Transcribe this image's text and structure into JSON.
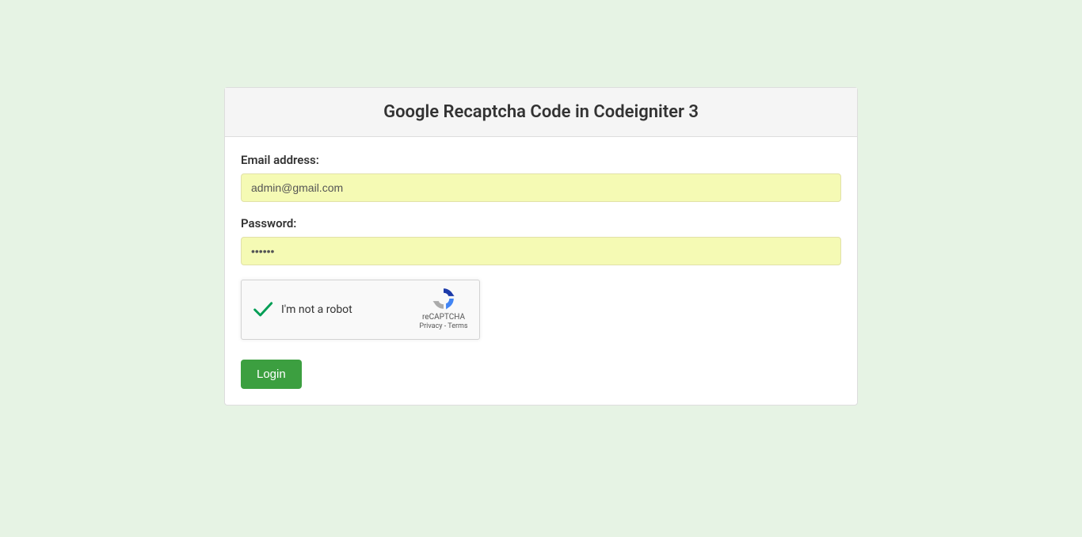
{
  "panel": {
    "title": "Google Recaptcha Code in Codeigniter 3"
  },
  "form": {
    "email_label": "Email address:",
    "email_value": "admin@gmail.com",
    "password_label": "Password:",
    "password_value": "••••••",
    "login_button": "Login"
  },
  "recaptcha": {
    "label": "I'm not a robot",
    "brand": "reCAPTCHA",
    "privacy": "Privacy",
    "separator": " - ",
    "terms": "Terms"
  }
}
